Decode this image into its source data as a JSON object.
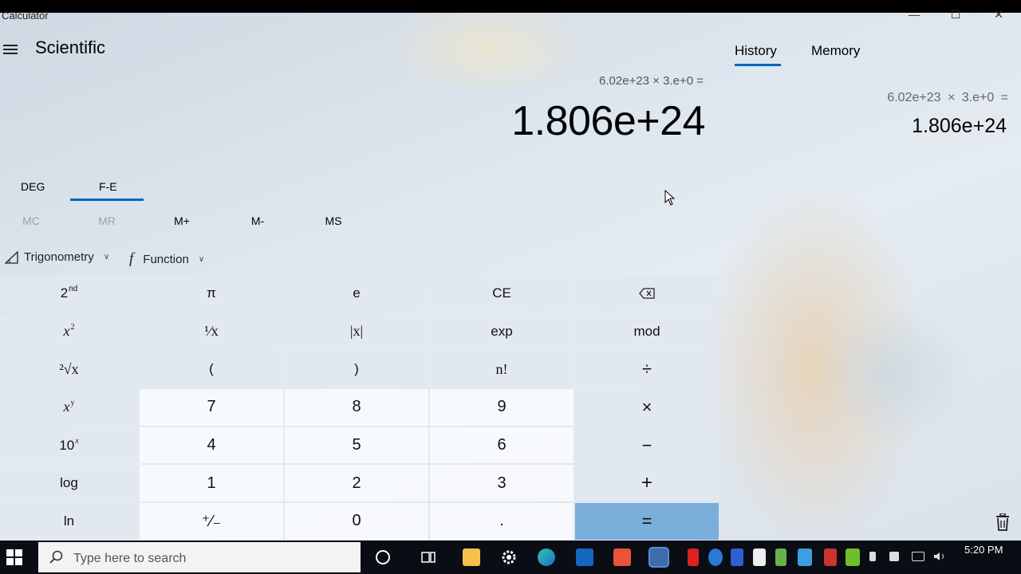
{
  "window": {
    "title": "Calculator",
    "minimize": "—",
    "maximize": "☐",
    "close": "✕"
  },
  "header": {
    "mode": "Scientific"
  },
  "display": {
    "expression": "6.02e+23 × 3.e+0 =",
    "result": "1.806e+24"
  },
  "side_panel": {
    "tabs": [
      "History",
      "Memory"
    ],
    "active_tab": "History",
    "history": [
      {
        "expression": "6.02e+23 × 3.e+0 =",
        "result": "1.806e+24"
      }
    ]
  },
  "modes": {
    "angle": "DEG",
    "fe": "F-E"
  },
  "memory": [
    "MC",
    "MR",
    "M+",
    "M-",
    "MS"
  ],
  "functions": {
    "trig": "Trigonometry",
    "func": "Function"
  },
  "keys": {
    "second": "2",
    "second_sup": "nd",
    "pi": "π",
    "e": "e",
    "ce": "CE",
    "square": "x",
    "square_sup": "2",
    "reciprocal": "¹⁄x",
    "abs": "|x|",
    "exp": "exp",
    "mod": "mod",
    "sqrt": "²√x",
    "lparen": "(",
    "rparen": ")",
    "fact": "n!",
    "divide": "÷",
    "pow": "x",
    "pow_sup": "y",
    "k7": "7",
    "k8": "8",
    "k9": "9",
    "multiply": "×",
    "ten_pow": "10",
    "ten_pow_sup": "x",
    "k4": "4",
    "k5": "5",
    "k6": "6",
    "minus": "−",
    "log": "log",
    "k1": "1",
    "k2": "2",
    "k3": "3",
    "plus": "+",
    "ln": "ln",
    "negate": "⁺⁄₋",
    "k0": "0",
    "decimal": ".",
    "equals": "="
  },
  "taskbar": {
    "search_placeholder": "Type here to search",
    "time": "5:20 PM"
  },
  "colors": {
    "accent": "#0067c0",
    "equals_key": "#7aaedb"
  }
}
